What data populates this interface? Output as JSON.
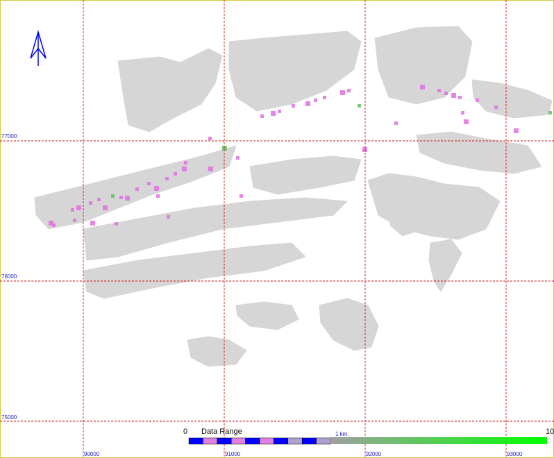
{
  "map": {
    "grid": {
      "x_labels": [
        "90000",
        "91000",
        "92000",
        "93000"
      ],
      "y_labels": [
        "77000",
        "76000",
        "75000"
      ]
    },
    "north_arrow_icon": "north-arrow-icon",
    "legend": {
      "title": "Data Range",
      "min_label": "0",
      "max_label": "10",
      "scale_label": "1 km.",
      "colors": {
        "scale_bar_dark": "#0000ff",
        "scale_bar_light": "#e080e0",
        "gradient_start": "#a0a0a0",
        "gradient_end": "#00ff00"
      }
    },
    "colors": {
      "grid": "#d01010",
      "footprint": "#d6d6d6",
      "highlight_magenta": "#e070e0",
      "highlight_green": "#60c060",
      "label_blue": "#2020d0"
    }
  }
}
